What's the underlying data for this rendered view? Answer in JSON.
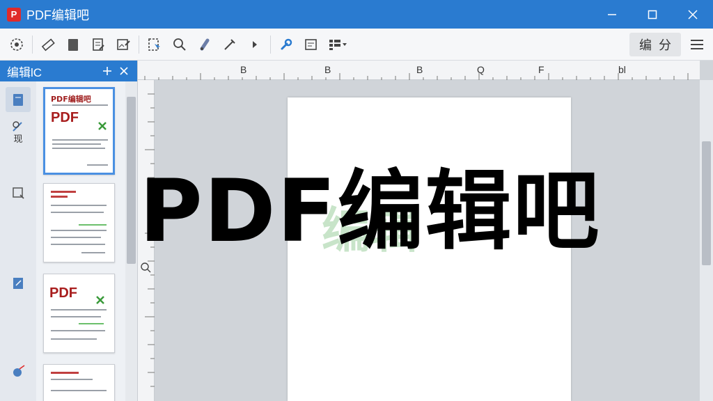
{
  "window": {
    "logo_letter": "P",
    "title": "PDF编辑吧"
  },
  "toolbar": {
    "right_group": [
      "编",
      "分"
    ],
    "icons": [
      "select-icon",
      "eraser-icon",
      "document-icon",
      "edit-page-icon",
      "image-edit-icon",
      "ocr-select-icon",
      "zoom-icon",
      "link-icon",
      "pen-icon",
      "play-icon",
      "wrench-icon",
      "form-icon",
      "layout-icon"
    ]
  },
  "sidepanel": {
    "header_title": "编辑lC",
    "tool_label": "现",
    "thumbnails": [
      {
        "title": "PDF编辑吧",
        "big": "PDF"
      },
      {
        "title": "",
        "big": ""
      },
      {
        "title": "",
        "big": "PDF"
      },
      {
        "title": "",
        "big": ""
      }
    ]
  },
  "ruler": {
    "labels": [
      "B",
      "B",
      "B",
      "Q",
      "F",
      "bl"
    ]
  },
  "canvas": {
    "ghost_text": "编辑",
    "overlay_title": "PDF编辑吧"
  },
  "colors": {
    "accent": "#2a7bd0",
    "logo_red": "#e02a2a"
  }
}
